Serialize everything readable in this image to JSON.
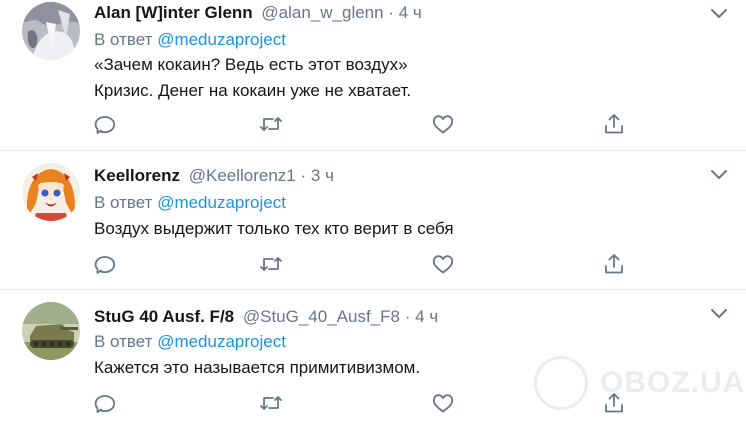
{
  "tweets": [
    {
      "name": "Alan [W]inter Glenn",
      "handle": "@alan_w_glenn",
      "dot": "·",
      "time": "4 ч",
      "reply_prefix": "В ответ",
      "reply_to": "@meduzaproject",
      "lines": [
        "«Зачем кокаин? Ведь есть этот воздух»",
        "Кризис. Денег на кокаин уже не хватает."
      ],
      "avatar_icon": "anime-avatar-icon"
    },
    {
      "name": "Keellorenz",
      "handle": "@Keellorenz1",
      "dot": "·",
      "time": "3 ч",
      "reply_prefix": "В ответ",
      "reply_to": "@meduzaproject",
      "lines": [
        "Воздух выдержит только тех кто верит в себя"
      ],
      "avatar_icon": "anime-girl-avatar-icon"
    },
    {
      "name": "StuG 40 Ausf. F/8",
      "handle": "@StuG_40_Ausf_F8",
      "dot": "·",
      "time": "4 ч",
      "reply_prefix": "В ответ",
      "reply_to": "@meduzaproject",
      "lines": [
        "Кажется это называется примитивизмом."
      ],
      "avatar_icon": "tank-avatar-icon"
    }
  ],
  "icons": {
    "reply": "reply-icon",
    "retweet": "retweet-icon",
    "like": "heart-icon",
    "share": "share-icon",
    "caret": "chevron-down-icon"
  },
  "colors": {
    "text": "#14171a",
    "muted": "#657786",
    "link": "#1b95e0",
    "divider": "#e6ecf0"
  },
  "watermark": {
    "text": "OBOZ.UA"
  }
}
